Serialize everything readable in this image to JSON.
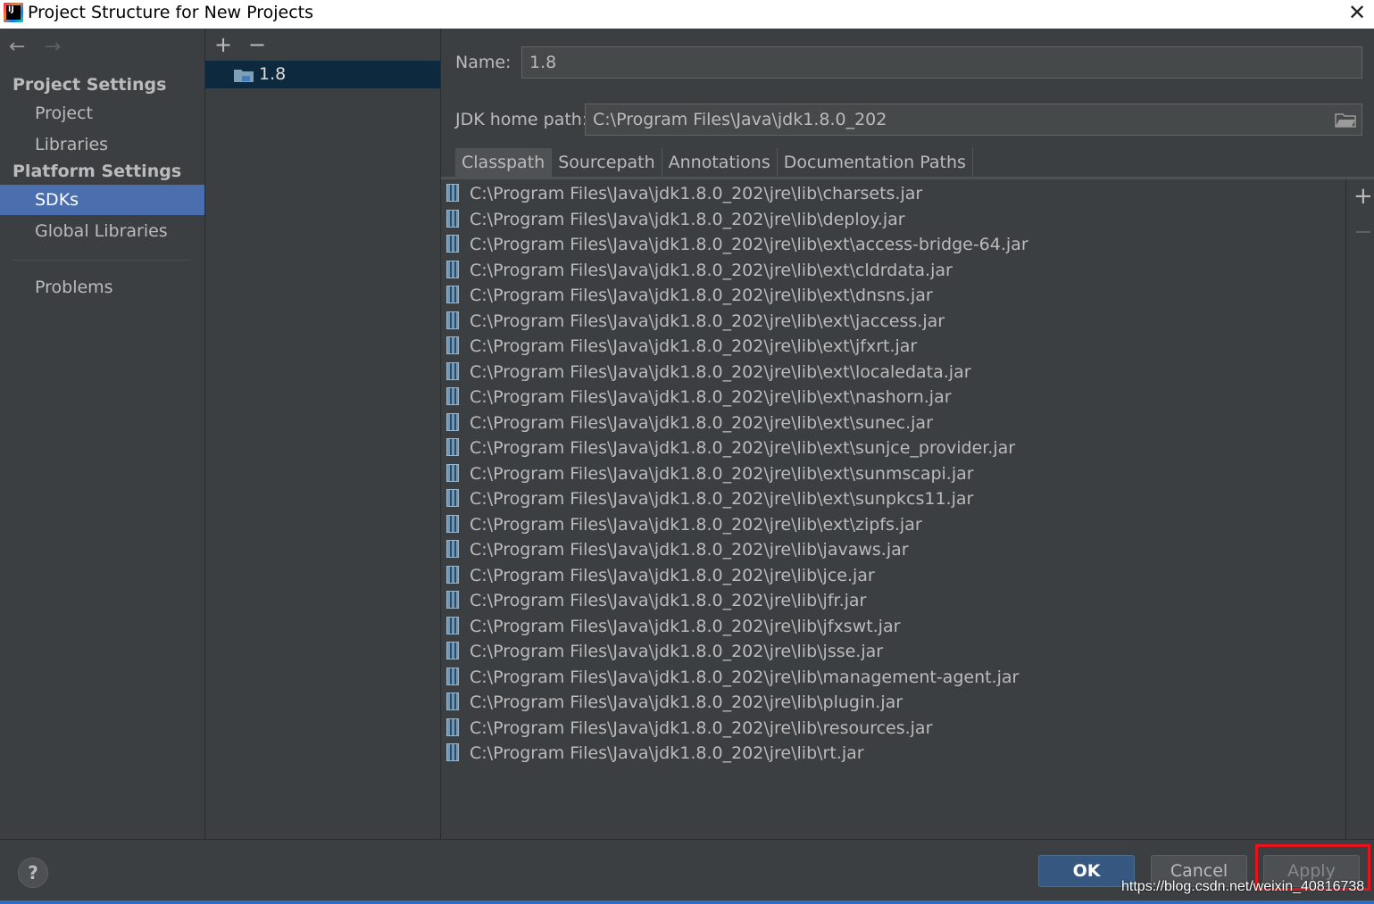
{
  "window": {
    "title": "Project Structure for New Projects",
    "close": "✕"
  },
  "sidebar": {
    "back": "←",
    "forward": "→",
    "project_settings": "Project Settings",
    "items_project": [
      {
        "label": "Project"
      },
      {
        "label": "Libraries"
      }
    ],
    "platform_settings": "Platform Settings",
    "items_platform": [
      {
        "label": "SDKs",
        "selected": true
      },
      {
        "label": "Global Libraries"
      }
    ],
    "problems": "Problems"
  },
  "sdk_list": {
    "add": "+",
    "remove": "−",
    "items": [
      {
        "label": "1.8",
        "selected": true
      }
    ]
  },
  "detail": {
    "name_label": "Name:",
    "name_value": "1.8",
    "jdk_label": "JDK home path:",
    "jdk_value": "C:\\Program Files\\Java\\jdk1.8.0_202",
    "tabs": [
      {
        "label": "Classpath",
        "active": true
      },
      {
        "label": "Sourcepath"
      },
      {
        "label": "Annotations"
      },
      {
        "label": "Documentation Paths"
      }
    ],
    "classpath": [
      "C:\\Program Files\\Java\\jdk1.8.0_202\\jre\\lib\\charsets.jar",
      "C:\\Program Files\\Java\\jdk1.8.0_202\\jre\\lib\\deploy.jar",
      "C:\\Program Files\\Java\\jdk1.8.0_202\\jre\\lib\\ext\\access-bridge-64.jar",
      "C:\\Program Files\\Java\\jdk1.8.0_202\\jre\\lib\\ext\\cldrdata.jar",
      "C:\\Program Files\\Java\\jdk1.8.0_202\\jre\\lib\\ext\\dnsns.jar",
      "C:\\Program Files\\Java\\jdk1.8.0_202\\jre\\lib\\ext\\jaccess.jar",
      "C:\\Program Files\\Java\\jdk1.8.0_202\\jre\\lib\\ext\\jfxrt.jar",
      "C:\\Program Files\\Java\\jdk1.8.0_202\\jre\\lib\\ext\\localedata.jar",
      "C:\\Program Files\\Java\\jdk1.8.0_202\\jre\\lib\\ext\\nashorn.jar",
      "C:\\Program Files\\Java\\jdk1.8.0_202\\jre\\lib\\ext\\sunec.jar",
      "C:\\Program Files\\Java\\jdk1.8.0_202\\jre\\lib\\ext\\sunjce_provider.jar",
      "C:\\Program Files\\Java\\jdk1.8.0_202\\jre\\lib\\ext\\sunmscapi.jar",
      "C:\\Program Files\\Java\\jdk1.8.0_202\\jre\\lib\\ext\\sunpkcs11.jar",
      "C:\\Program Files\\Java\\jdk1.8.0_202\\jre\\lib\\ext\\zipfs.jar",
      "C:\\Program Files\\Java\\jdk1.8.0_202\\jre\\lib\\javaws.jar",
      "C:\\Program Files\\Java\\jdk1.8.0_202\\jre\\lib\\jce.jar",
      "C:\\Program Files\\Java\\jdk1.8.0_202\\jre\\lib\\jfr.jar",
      "C:\\Program Files\\Java\\jdk1.8.0_202\\jre\\lib\\jfxswt.jar",
      "C:\\Program Files\\Java\\jdk1.8.0_202\\jre\\lib\\jsse.jar",
      "C:\\Program Files\\Java\\jdk1.8.0_202\\jre\\lib\\management-agent.jar",
      "C:\\Program Files\\Java\\jdk1.8.0_202\\jre\\lib\\plugin.jar",
      "C:\\Program Files\\Java\\jdk1.8.0_202\\jre\\lib\\resources.jar",
      "C:\\Program Files\\Java\\jdk1.8.0_202\\jre\\lib\\rt.jar"
    ],
    "add": "+",
    "remove": "−"
  },
  "footer": {
    "help": "?",
    "ok": "OK",
    "cancel": "Cancel",
    "apply": "Apply",
    "watermark": "https://blog.csdn.net/weixin_40816738"
  },
  "colors": {
    "selection": "#4b6eaf",
    "ok_button": "#365880",
    "highlight_box": "#e8131a"
  }
}
